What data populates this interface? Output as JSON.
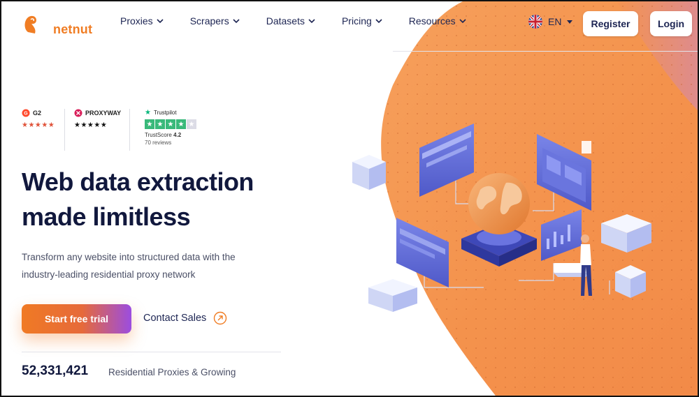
{
  "brand": {
    "logo_text": "netnut",
    "accent": "#f07d24",
    "navy": "#11183d"
  },
  "nav": {
    "items": [
      {
        "label": "Proxies"
      },
      {
        "label": "Scrapers"
      },
      {
        "label": "Datasets"
      },
      {
        "label": "Pricing"
      },
      {
        "label": "Resources"
      }
    ],
    "language": "EN",
    "register_label": "Register",
    "login_label": "Login"
  },
  "ratings": {
    "g2": {
      "name": "G2",
      "stars": "★★★★★"
    },
    "proxyway": {
      "name": "PROXYWAY",
      "stars": "★★★★★"
    },
    "trustpilot": {
      "name": "Trustpilot",
      "score_label": "TrustScore",
      "score": "4.2",
      "reviews": "70 reviews"
    }
  },
  "hero": {
    "headline_line1": "Web data extraction",
    "headline_line2": "made limitless",
    "subtext_line1": "Transform any website into structured data with the",
    "subtext_line2": "industry-leading residential proxy network",
    "cta_primary": "Start free trial",
    "cta_secondary": "Contact Sales"
  },
  "stats": {
    "count": "52,331,421",
    "label": "Residential Proxies & Growing"
  }
}
